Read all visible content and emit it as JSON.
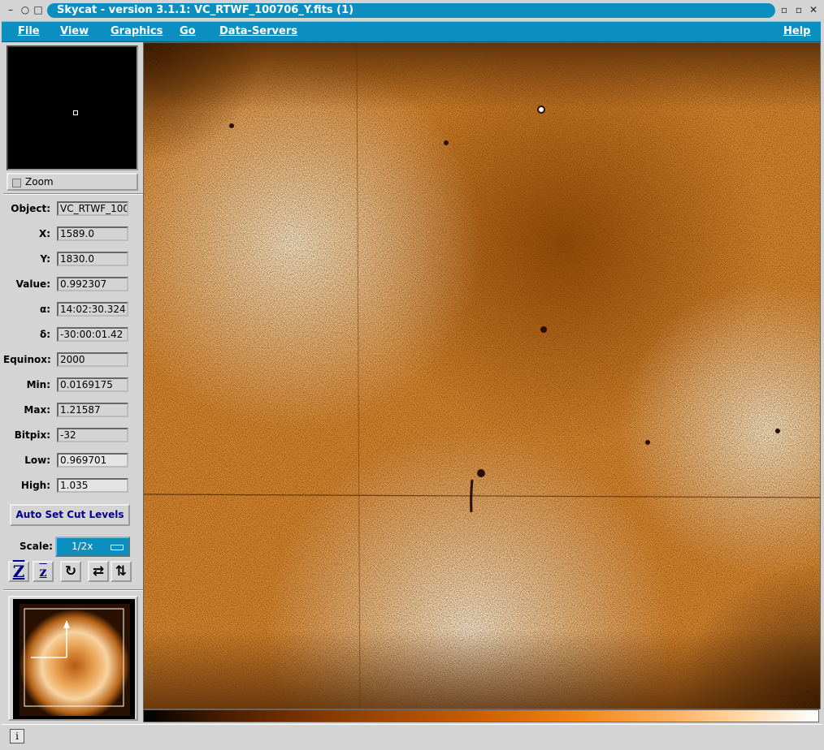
{
  "window": {
    "title": "Skycat - version 3.1.1: VC_RTWF_100706_Y.fits (1)",
    "controls": {
      "menu": "–",
      "iconify": "○",
      "maximize": "□",
      "restore_left": "▫",
      "restore_right": "▫",
      "close": "✕"
    }
  },
  "menubar": {
    "items": [
      {
        "label": "File"
      },
      {
        "label": "View"
      },
      {
        "label": "Graphics"
      },
      {
        "label": "Go"
      },
      {
        "label": "Data-Servers"
      }
    ],
    "help": "Help"
  },
  "zoom": {
    "label": "Zoom",
    "checked": false
  },
  "info": {
    "object": {
      "label": "Object:",
      "value": "VC_RTWF_100706_Y"
    },
    "x": {
      "label": "X:",
      "value": "1589.0"
    },
    "y": {
      "label": "Y:",
      "value": "1830.0"
    },
    "value": {
      "label": "Value:",
      "value": "0.992307"
    },
    "ra": {
      "label": "α:",
      "value": "14:02:30.324"
    },
    "dec": {
      "label": "δ:",
      "value": "-30:00:01.42"
    },
    "equinox": {
      "label": "Equinox:",
      "value": "2000"
    },
    "min": {
      "label": "Min:",
      "value": "0.0169175"
    },
    "max": {
      "label": "Max:",
      "value": "1.21587"
    },
    "bitpix": {
      "label": "Bitpix:",
      "value": "-32"
    },
    "low": {
      "label": "Low:",
      "value": "0.969701"
    },
    "high": {
      "label": "High:",
      "value": "1.035"
    }
  },
  "buttons": {
    "auto_cut": "Auto Set Cut Levels"
  },
  "scale": {
    "label": "Scale:",
    "value": "1/2x"
  },
  "tools": {
    "zoom_in": "Z",
    "zoom_out": "z",
    "rotate": "↻",
    "flip_x": "⇄",
    "flip_y": "⇅"
  },
  "colors": {
    "accent": "#0b8fc0",
    "image_dark": "#7a3300",
    "image_mid": "#e08020",
    "image_light": "#fff2dc"
  },
  "status": {
    "icon": "i"
  }
}
